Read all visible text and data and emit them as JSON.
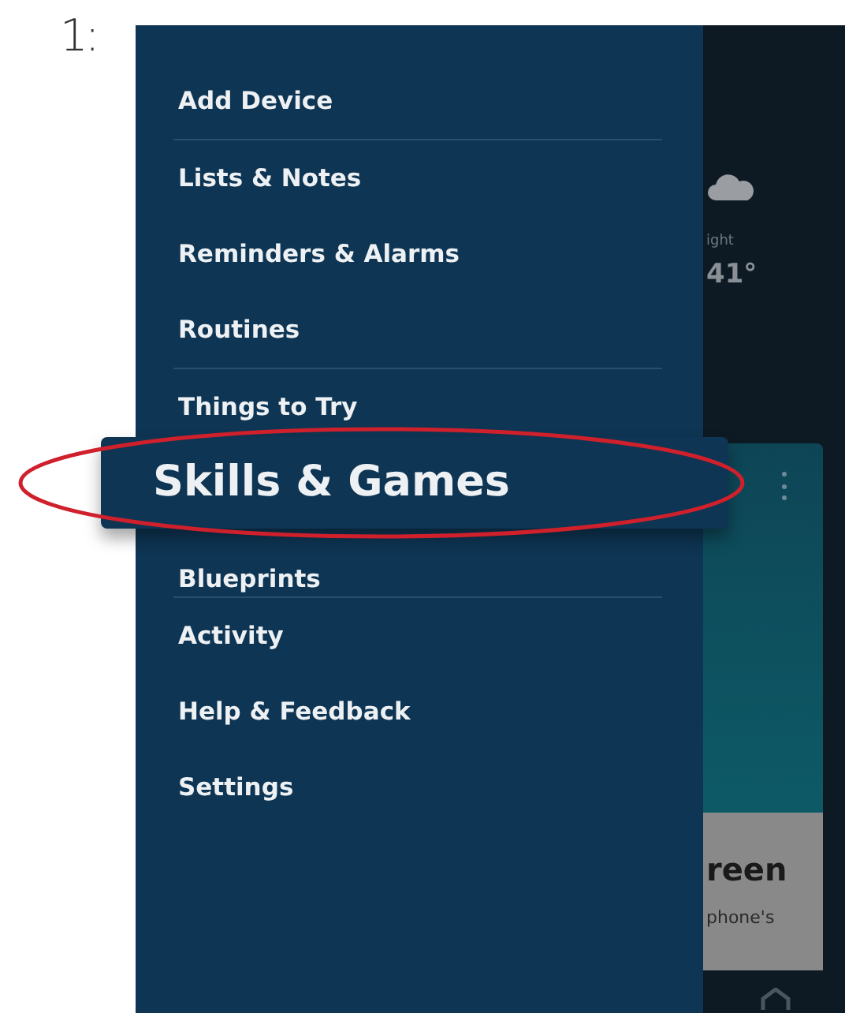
{
  "annotation": {
    "label": "1:"
  },
  "menu": {
    "items": [
      {
        "label": "Add Device",
        "kind": "plain",
        "divider_after": true
      },
      {
        "label": "Lists & Notes",
        "kind": "plain",
        "divider_after": false
      },
      {
        "label": "Reminders & Alarms",
        "kind": "plain",
        "divider_after": false
      },
      {
        "label": "Routines",
        "kind": "plain",
        "divider_after": true
      },
      {
        "label": "Things to Try",
        "kind": "plain",
        "divider_after": false
      },
      {
        "label": "Skills & Games",
        "kind": "callout",
        "divider_after": false
      },
      {
        "label": "Blueprints",
        "kind": "plain",
        "divider_after": true
      },
      {
        "label": "Activity",
        "kind": "plain",
        "divider_after": false
      },
      {
        "label": "Help & Feedback",
        "kind": "plain",
        "divider_after": false
      },
      {
        "label": "Settings",
        "kind": "plain",
        "divider_after": false
      }
    ]
  },
  "background": {
    "weather": {
      "label": "ight",
      "temperature": "41°"
    },
    "card": {
      "title": "reen",
      "text": "phone's"
    }
  }
}
